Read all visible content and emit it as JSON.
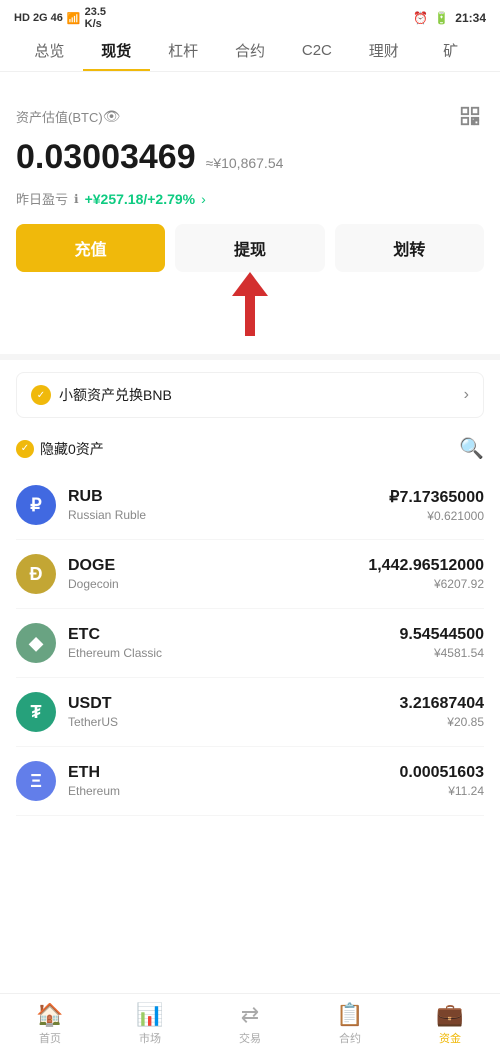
{
  "statusBar": {
    "left": "HD 26 46",
    "signal": "23.5 K/s",
    "time": "21:34"
  },
  "nav": {
    "tabs": [
      {
        "id": "overview",
        "label": "总览"
      },
      {
        "id": "spot",
        "label": "现货",
        "active": true
      },
      {
        "id": "leverage",
        "label": "杠杆"
      },
      {
        "id": "contract",
        "label": "合约"
      },
      {
        "id": "c2c",
        "label": "C2C"
      },
      {
        "id": "finance",
        "label": "理财"
      },
      {
        "id": "mine",
        "label": "矿"
      }
    ]
  },
  "asset": {
    "label": "资产估值(BTC)",
    "btc": "0.03003469",
    "approx": "≈¥10,867.54",
    "pnl_label": "昨日盈亏",
    "pnl_value": "+¥257.18/+2.79%"
  },
  "buttons": {
    "deposit": "充值",
    "withdraw": "提现",
    "transfer": "划转"
  },
  "bnbBanner": {
    "text": "小额资产兑换BNB"
  },
  "filter": {
    "label": "隐藏0资产"
  },
  "coins": [
    {
      "id": "rub",
      "symbol": "RUB",
      "name": "Russian Ruble",
      "amount": "₽7.17365000",
      "cny": "¥0.621000",
      "iconClass": "rub",
      "iconText": "₽"
    },
    {
      "id": "doge",
      "symbol": "DOGE",
      "name": "Dogecoin",
      "amount": "1,442.96512000",
      "cny": "¥6207.92",
      "iconClass": "doge",
      "iconText": "Ð"
    },
    {
      "id": "etc",
      "symbol": "ETC",
      "name": "Ethereum Classic",
      "amount": "9.54544500",
      "cny": "¥4581.54",
      "iconClass": "etc",
      "iconText": "◆"
    },
    {
      "id": "usdt",
      "symbol": "USDT",
      "name": "TetherUS",
      "amount": "3.21687404",
      "cny": "¥20.85",
      "iconClass": "usdt",
      "iconText": "₮"
    },
    {
      "id": "eth",
      "symbol": "ETH",
      "name": "Ethereum",
      "amount": "0.00051603",
      "cny": "¥11.24",
      "iconClass": "eth",
      "iconText": "Ξ"
    }
  ],
  "bottomNav": [
    {
      "id": "home",
      "label": "首页",
      "icon": "⌂",
      "active": false
    },
    {
      "id": "market",
      "label": "市场",
      "icon": "📊",
      "active": false
    },
    {
      "id": "trade",
      "label": "交易",
      "icon": "↔",
      "active": false
    },
    {
      "id": "contract",
      "label": "合约",
      "icon": "📄",
      "active": false
    },
    {
      "id": "asset",
      "label": "资金",
      "icon": "💼",
      "active": true
    }
  ]
}
